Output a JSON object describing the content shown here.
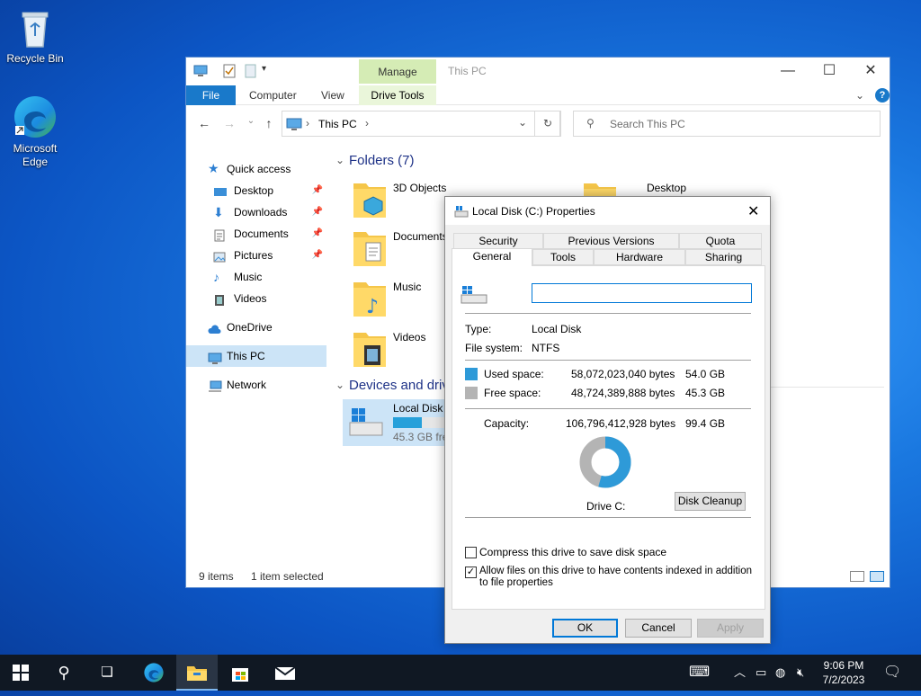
{
  "desktop": {
    "icons": [
      {
        "label": "Recycle Bin",
        "icon": "recycle-bin-icon"
      },
      {
        "label": "Microsoft\nEdge",
        "icon": "edge-icon"
      }
    ]
  },
  "explorer": {
    "title": "This PC",
    "manage_label": "Manage",
    "ribbon_tabs": [
      "File",
      "Computer",
      "View"
    ],
    "drive_tools_label": "Drive Tools",
    "address": "This PC",
    "search_placeholder": "Search This PC",
    "nav": [
      {
        "label": "Quick access",
        "icon": "star-icon"
      },
      {
        "label": "Desktop",
        "icon": "desktop-icon",
        "pinned": true
      },
      {
        "label": "Downloads",
        "icon": "download-icon",
        "pinned": true
      },
      {
        "label": "Documents",
        "icon": "documents-icon",
        "pinned": true
      },
      {
        "label": "Pictures",
        "icon": "pictures-icon",
        "pinned": true
      },
      {
        "label": "Music",
        "icon": "music-icon"
      },
      {
        "label": "Videos",
        "icon": "videos-icon"
      },
      {
        "label": "OneDrive",
        "icon": "cloud-icon"
      },
      {
        "label": "This PC",
        "icon": "computer-icon",
        "selected": true
      },
      {
        "label": "Network",
        "icon": "network-icon"
      }
    ],
    "folders_header": "Folders (7)",
    "folders": [
      "3D Objects",
      "Desktop",
      "Documents",
      "Music",
      "Videos"
    ],
    "devices_header": "Devices and drives",
    "drive": {
      "label": "Local Disk (C:)",
      "free_text": "45.3 GB free of 99.4 GB",
      "used_fraction": 0.54
    },
    "status": {
      "items": "9 items",
      "selected": "1 item selected"
    }
  },
  "properties": {
    "title": "Local Disk (C:) Properties",
    "tabs_back": [
      "Security",
      "Previous Versions",
      "Quota"
    ],
    "tabs_front": [
      "General",
      "Tools",
      "Hardware",
      "Sharing"
    ],
    "active_tab": "General",
    "name_value": "",
    "type_label": "Type:",
    "type_value": "Local Disk",
    "fs_label": "File system:",
    "fs_value": "NTFS",
    "used_label": "Used space:",
    "used_bytes": "58,072,023,040 bytes",
    "used_gb": "54.0 GB",
    "free_label": "Free space:",
    "free_bytes": "48,724,389,888 bytes",
    "free_gb": "45.3 GB",
    "capacity_label": "Capacity:",
    "capacity_bytes": "106,796,412,928 bytes",
    "capacity_gb": "99.4 GB",
    "drive_label": "Drive C:",
    "disk_cleanup": "Disk Cleanup",
    "compress_label": "Compress this drive to save disk space",
    "compress_checked": false,
    "index_label": "Allow files on this drive to have contents indexed in addition to file properties",
    "index_checked": true,
    "ok": "OK",
    "cancel": "Cancel",
    "apply": "Apply",
    "used_color": "#2e9ad8",
    "free_color": "#b4b4b4"
  },
  "taskbar": {
    "time": "9:06 PM",
    "date": "7/2/2023"
  }
}
